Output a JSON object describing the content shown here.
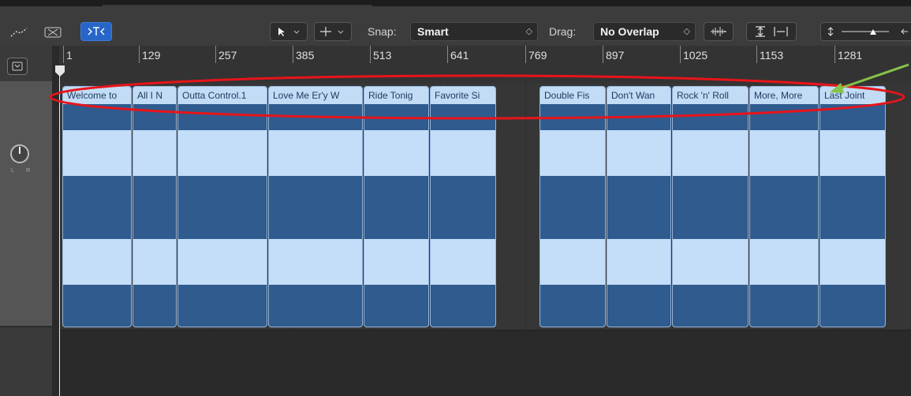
{
  "toolbar": {
    "snap_label": "Snap:",
    "snap_value": "Smart",
    "drag_label": "Drag:",
    "drag_value": "No Overlap",
    "icons": [
      "automation-icon",
      "flex-icon",
      "catch-icon",
      "pointer-tool-icon",
      "marquee-tool-icon",
      "waveform-zoom-icon",
      "vertical-zoom-icon",
      "horizontal-zoom-icon",
      "track-height-icon"
    ]
  },
  "ruler": {
    "ticks": [
      "1",
      "129",
      "257",
      "385",
      "513",
      "641",
      "769",
      "897",
      "1025",
      "1153",
      "1281"
    ]
  },
  "regions": [
    {
      "title": "Welcome to"
    },
    {
      "title": "All I N"
    },
    {
      "title": "Outta Control.1"
    },
    {
      "title": "Love Me Er'y W"
    },
    {
      "title": "Ride Tonig"
    },
    {
      "title": "Favorite Si"
    },
    {
      "title": "Double Fis"
    },
    {
      "title": "Don't Wan"
    },
    {
      "title": "Rock 'n' Roll"
    },
    {
      "title": "More, More"
    },
    {
      "title": "Last Joint"
    }
  ],
  "sidebar": {
    "pan_left": "L",
    "pan_right": "R"
  },
  "annotation": {
    "ellipse_color": "#e8141a",
    "arrow_color": "#86c24a"
  }
}
